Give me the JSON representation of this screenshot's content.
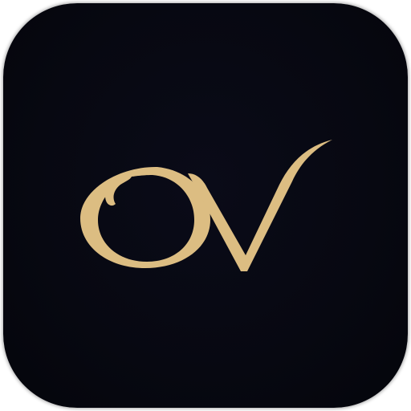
{
  "app_icon": {
    "logo_text": "OV",
    "colors": {
      "background": "#070811",
      "gold": "#dcbd82"
    }
  }
}
